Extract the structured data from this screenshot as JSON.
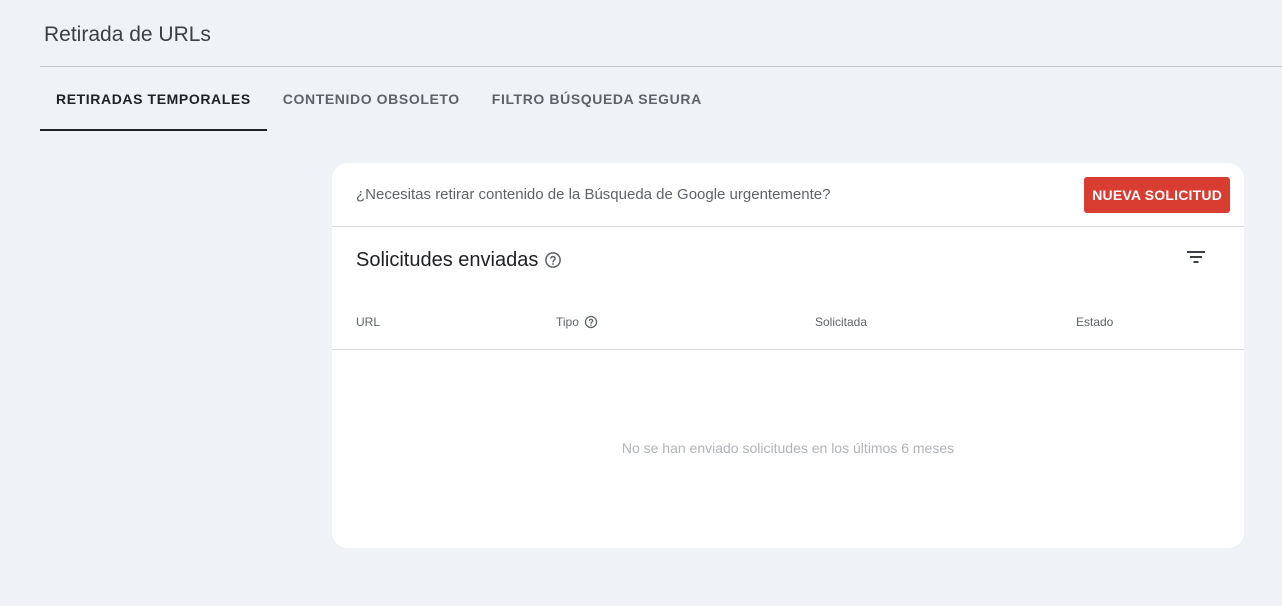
{
  "header": {
    "title": "Retirada de URLs"
  },
  "tabs": [
    {
      "label": "RETIRADAS TEMPORALES",
      "active": true
    },
    {
      "label": "CONTENIDO OBSOLETO",
      "active": false
    },
    {
      "label": "FILTRO BÚSQUEDA SEGURA",
      "active": false
    }
  ],
  "banner": {
    "text": "¿Necesitas retirar contenido de la Búsqueda de Google urgentemente?",
    "button_label": "NUEVA SOLICITUD"
  },
  "requests": {
    "title": "Solicitudes enviadas",
    "columns": [
      "URL",
      "Tipo",
      "Solicitada",
      "Estado"
    ],
    "empty_message": "No se han enviado solicitudes en los últimos 6 meses"
  },
  "colors": {
    "background": "#eff3f8",
    "card": "#ffffff",
    "accent_red": "#d93c30",
    "text_primary": "#202124",
    "text_secondary": "#5f6368"
  },
  "icons": {
    "help": "help-circle-icon",
    "filter": "filter-list-icon"
  }
}
